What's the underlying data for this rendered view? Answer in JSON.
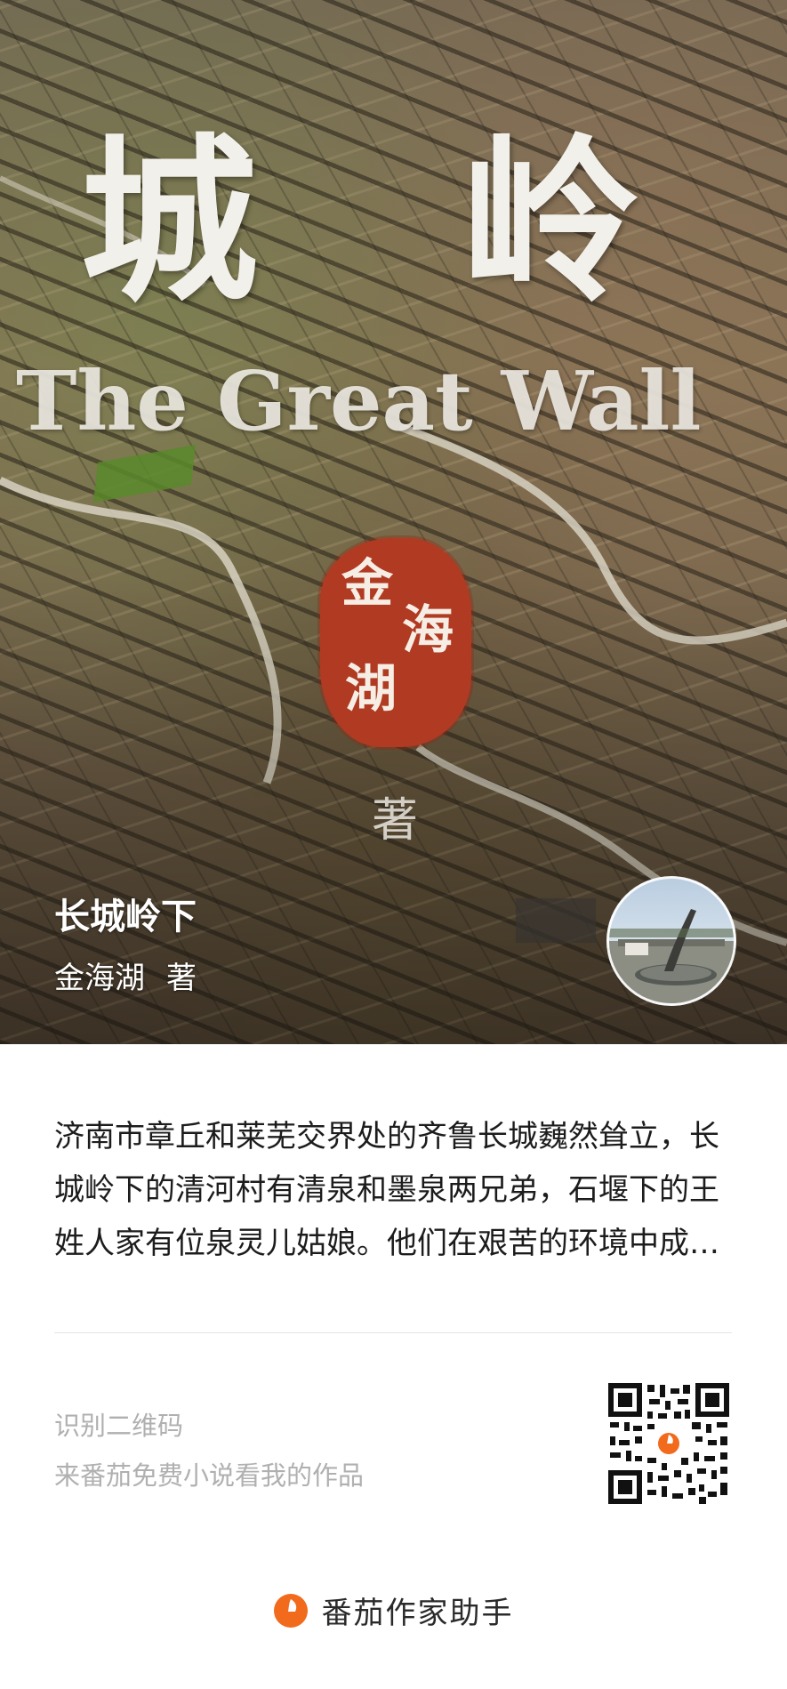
{
  "cover": {
    "title_text": "城  岭",
    "subtitle_text": "The Great Wall",
    "seal_chars": [
      "金",
      "海",
      "湖"
    ],
    "by_text": "著"
  },
  "book": {
    "title": "长城岭下",
    "author": "金海湖",
    "author_suffix": "著"
  },
  "synopsis": "济南市章丘和莱芜交界处的齐鲁长城巍然耸立，长城岭下的清河村有清泉和墨泉两兄弟，石堰下的王姓人家有位泉灵儿姑娘。他们在艰苦的环境中成长，演绎了一段感人的故事",
  "qr_section": {
    "line1": "识别二维码",
    "line2": "来番茄免费小说看我的作品"
  },
  "footer": {
    "brand_name": "番茄作家助手"
  },
  "colors": {
    "accent": "#f26a1b",
    "seal": "#b03a22"
  }
}
